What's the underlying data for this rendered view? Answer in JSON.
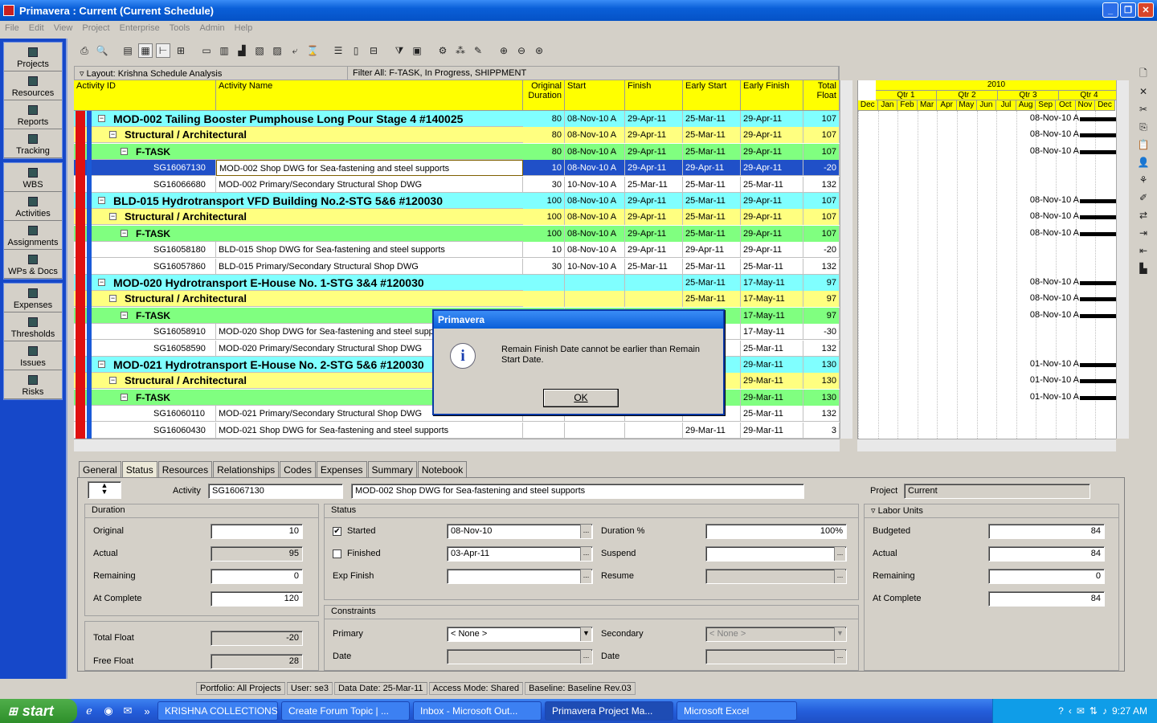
{
  "window": {
    "title": "Primavera : Current (Current Schedule)"
  },
  "menu": [
    "File",
    "Edit",
    "View",
    "Project",
    "Enterprise",
    "Tools",
    "Admin",
    "Help"
  ],
  "sidebar": {
    "items": [
      {
        "label": "Projects",
        "icon": "projects-icon"
      },
      {
        "label": "Resources",
        "icon": "resources-icon"
      },
      {
        "label": "Reports",
        "icon": "reports-icon"
      },
      {
        "label": "Tracking",
        "icon": "tracking-icon"
      },
      {
        "label": "WBS",
        "icon": "wbs-icon"
      },
      {
        "label": "Activities",
        "icon": "activities-icon"
      },
      {
        "label": "Assignments",
        "icon": "assignments-icon"
      },
      {
        "label": "WPs & Docs",
        "icon": "docs-icon"
      },
      {
        "label": "Expenses",
        "icon": "expenses-icon"
      },
      {
        "label": "Thresholds",
        "icon": "thresholds-icon"
      },
      {
        "label": "Issues",
        "icon": "issues-icon"
      },
      {
        "label": "Risks",
        "icon": "risks-icon"
      }
    ]
  },
  "layoutbar": {
    "layout": "Layout: Krishna Schedule Analysis",
    "filter": "Filter All: F-TASK, In Progress, SHIPPMENT"
  },
  "grid": {
    "columns": {
      "id": "Activity ID",
      "name": "Activity Name",
      "dur": "Original Duration",
      "start": "Start",
      "finish": "Finish",
      "es": "Early Start",
      "ef": "Early Finish",
      "tf": "Total Float"
    },
    "rows": [
      {
        "level": 0,
        "id": "",
        "name": "MOD-002 Tailing Booster Pumphouse Long Pour Stage 4 #140025",
        "dur": "80",
        "start": "08-Nov-10 A",
        "finish": "29-Apr-11",
        "es": "25-Mar-11",
        "ef": "29-Apr-11",
        "tf": "107"
      },
      {
        "level": 1,
        "id": "",
        "name": "Structural / Architectural",
        "dur": "80",
        "start": "08-Nov-10 A",
        "finish": "29-Apr-11",
        "es": "25-Mar-11",
        "ef": "29-Apr-11",
        "tf": "107"
      },
      {
        "level": 2,
        "id": "",
        "name": "F-TASK",
        "dur": "80",
        "start": "08-Nov-10 A",
        "finish": "29-Apr-11",
        "es": "25-Mar-11",
        "ef": "29-Apr-11",
        "tf": "107"
      },
      {
        "level": 3,
        "selected": true,
        "id": "SG16067130",
        "name": "MOD-002 Shop DWG for Sea-fastening and steel supports",
        "dur": "10",
        "start": "08-Nov-10 A",
        "finish": "29-Apr-11",
        "es": "29-Apr-11",
        "ef": "29-Apr-11",
        "tf": "-20"
      },
      {
        "level": 3,
        "id": "SG16066680",
        "name": "MOD-002  Primary/Secondary  Structural Shop DWG",
        "dur": "30",
        "start": "10-Nov-10 A",
        "finish": "25-Mar-11",
        "es": "25-Mar-11",
        "ef": "25-Mar-11",
        "tf": "132"
      },
      {
        "level": 0,
        "id": "",
        "name": "BLD-015 Hydrotransport VFD Building No.2-STG 5&6 #120030",
        "dur": "100",
        "start": "08-Nov-10 A",
        "finish": "29-Apr-11",
        "es": "25-Mar-11",
        "ef": "29-Apr-11",
        "tf": "107"
      },
      {
        "level": 1,
        "id": "",
        "name": "Structural / Architectural",
        "dur": "100",
        "start": "08-Nov-10 A",
        "finish": "29-Apr-11",
        "es": "25-Mar-11",
        "ef": "29-Apr-11",
        "tf": "107"
      },
      {
        "level": 2,
        "id": "",
        "name": "F-TASK",
        "dur": "100",
        "start": "08-Nov-10 A",
        "finish": "29-Apr-11",
        "es": "25-Mar-11",
        "ef": "29-Apr-11",
        "tf": "107"
      },
      {
        "level": 3,
        "id": "SG16058180",
        "name": "BLD-015 Shop DWG for Sea-fastening and steel supports",
        "dur": "10",
        "start": "08-Nov-10 A",
        "finish": "29-Apr-11",
        "es": "29-Apr-11",
        "ef": "29-Apr-11",
        "tf": "-20"
      },
      {
        "level": 3,
        "id": "SG16057860",
        "name": "BLD-015  Primary/Secondary  Structural Shop DWG",
        "dur": "30",
        "start": "10-Nov-10 A",
        "finish": "25-Mar-11",
        "es": "25-Mar-11",
        "ef": "25-Mar-11",
        "tf": "132"
      },
      {
        "level": 0,
        "id": "",
        "name": "MOD-020 Hydrotransport E-House No. 1-STG 3&4 #120030",
        "dur": "",
        "start": "",
        "finish": "",
        "es": "25-Mar-11",
        "ef": "17-May-11",
        "tf": "97"
      },
      {
        "level": 1,
        "id": "",
        "name": "Structural / Architectural",
        "dur": "",
        "start": "",
        "finish": "",
        "es": "25-Mar-11",
        "ef": "17-May-11",
        "tf": "97"
      },
      {
        "level": 2,
        "id": "",
        "name": "F-TASK",
        "dur": "",
        "start": "",
        "finish": "",
        "es": "",
        "ef": "17-May-11",
        "tf": "97"
      },
      {
        "level": 3,
        "id": "SG16058910",
        "name": "MOD-020 Shop DWG for Sea-fastening and steel supports",
        "dur": "",
        "start": "",
        "finish": "",
        "es": "",
        "ef": "17-May-11",
        "tf": "-30"
      },
      {
        "level": 3,
        "id": "SG16058590",
        "name": "MOD-020  Primary/Secondary  Structural Shop DWG",
        "dur": "",
        "start": "",
        "finish": "",
        "es": "",
        "ef": "25-Mar-11",
        "tf": "132"
      },
      {
        "level": 0,
        "id": "",
        "name": "MOD-021 Hydrotransport E-House No. 2-STG 5&6 #120030",
        "dur": "",
        "start": "",
        "finish": "",
        "es": "",
        "ef": "29-Mar-11",
        "tf": "130"
      },
      {
        "level": 1,
        "id": "",
        "name": "Structural / Architectural",
        "dur": "",
        "start": "",
        "finish": "",
        "es": "",
        "ef": "29-Mar-11",
        "tf": "130"
      },
      {
        "level": 2,
        "id": "",
        "name": "F-TASK",
        "dur": "",
        "start": "",
        "finish": "",
        "es": "",
        "ef": "29-Mar-11",
        "tf": "130"
      },
      {
        "level": 3,
        "id": "SG16060110",
        "name": "MOD-021  Primary/Secondary  Structural Shop DWG",
        "dur": "",
        "start": "",
        "finish": "",
        "es": "25-Mar-11",
        "ef": "25-Mar-11",
        "tf": "132"
      },
      {
        "level": 3,
        "id": "SG16060430",
        "name": "MOD-021 Shop DWG for Sea-fastening and steel supports",
        "dur": "",
        "start": "",
        "finish": "",
        "es": "29-Mar-11",
        "ef": "29-Mar-11",
        "tf": "3"
      }
    ]
  },
  "gantt": {
    "year": "2010",
    "quarters": [
      "Qtr 1",
      "Qtr 2",
      "Qtr 3",
      "Qtr 4"
    ],
    "months": [
      "Dec",
      "Jan",
      "Feb",
      "Mar",
      "Apr",
      "May",
      "Jun",
      "Jul",
      "Aug",
      "Sep",
      "Oct",
      "Nov",
      "Dec"
    ],
    "labels": [
      "08-Nov-10 A",
      "08-Nov-10 A",
      "08-Nov-10 A",
      "",
      "",
      "08-Nov-10 A",
      "08-Nov-10 A",
      "08-Nov-10 A",
      "",
      "",
      "08-Nov-10 A",
      "08-Nov-10 A",
      "08-Nov-10 A",
      "",
      "",
      "01-Nov-10 A",
      "01-Nov-10 A",
      "01-Nov-10 A",
      "",
      ""
    ]
  },
  "details": {
    "tabs": [
      "General",
      "Status",
      "Resources",
      "Relationships",
      "Codes",
      "Expenses",
      "Summary",
      "Notebook"
    ],
    "activity_label": "Activity",
    "activity_id": "SG16067130",
    "activity_name": "MOD-002 Shop DWG for Sea-fastening and steel supports",
    "project_label": "Project",
    "project": "Current",
    "duration": {
      "title": "Duration",
      "original_label": "Original",
      "original": "10",
      "actual_label": "Actual",
      "actual": "95",
      "remaining_label": "Remaining",
      "remaining": "0",
      "atcomplete_label": "At Complete",
      "atcomplete": "120"
    },
    "float": {
      "total_label": "Total Float",
      "total": "-20",
      "free_label": "Free Float",
      "free": "28"
    },
    "status": {
      "title": "Status",
      "started_label": "Started",
      "started": "08-Nov-10",
      "finished_label": "Finished",
      "finished": "03-Apr-11",
      "expfinish_label": "Exp Finish",
      "duration_pct_label": "Duration %",
      "duration_pct": "100%",
      "suspend_label": "Suspend",
      "resume_label": "Resume"
    },
    "constraints": {
      "title": "Constraints",
      "primary_label": "Primary",
      "primary": "< None >",
      "secondary_label": "Secondary",
      "secondary": "< None >",
      "date_label": "Date",
      "date2_label": "Date"
    },
    "labor": {
      "title": "Labor Units",
      "budgeted_label": "Budgeted",
      "budgeted": "84",
      "actual_label": "Actual",
      "actual": "84",
      "remaining_label": "Remaining",
      "remaining": "0",
      "atcomplete_label": "At Complete",
      "atcomplete": "84"
    }
  },
  "statusbar": {
    "portfolio": "Portfolio: All Projects",
    "user": "User: se3",
    "datadate": "Data Date: 25-Mar-11",
    "access": "Access Mode: Shared",
    "baseline": "Baseline: Baseline Rev.03"
  },
  "dialog": {
    "title": "Primavera",
    "message": "Remain Finish Date cannot be earlier than Remain Start Date.",
    "ok": "OK"
  },
  "taskbar": {
    "start": "start",
    "tasks": [
      "KRISHNA COLLECTIONS",
      "Create Forum Topic | ...",
      "Inbox - Microsoft Out...",
      "Primavera Project Ma...",
      "Microsoft Excel"
    ],
    "active_index": 3,
    "clock": "9:27 AM"
  },
  "colors": {
    "level0": "#80ffff",
    "level1": "#ffff80",
    "level2": "#80ff80",
    "selected": "#2050c8",
    "header": "#ffff00"
  }
}
